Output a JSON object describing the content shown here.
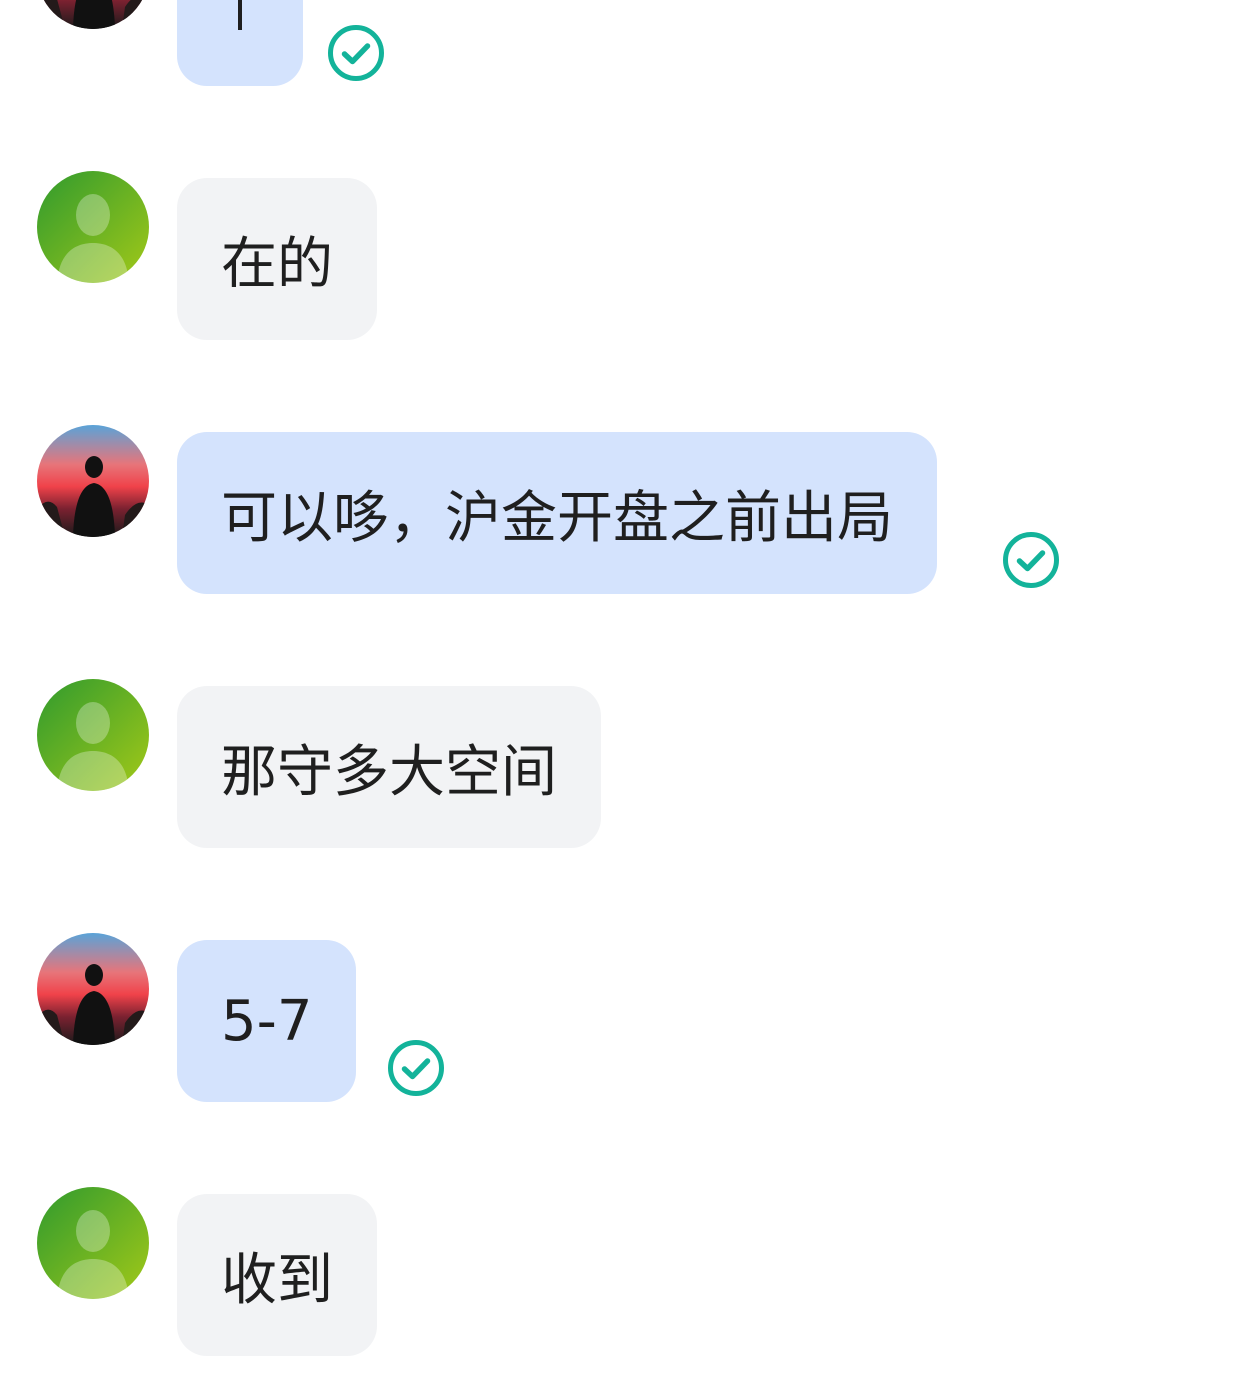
{
  "colors": {
    "sent_bubble": "#d4e3fd",
    "received_bubble": "#f2f3f5",
    "read_check": "#13b39a",
    "text": "#1f1f1f"
  },
  "messages": [
    {
      "direction": "sent",
      "text": "",
      "status_icon": "read-check-icon",
      "avatar": "sunset-silhouette-avatar"
    },
    {
      "direction": "received",
      "text": "在的",
      "avatar": "default-green-avatar"
    },
    {
      "direction": "sent",
      "text": "可以哆，沪金开盘之前出局",
      "status_icon": "read-check-icon",
      "avatar": "sunset-silhouette-avatar"
    },
    {
      "direction": "received",
      "text": "那守多大空间",
      "avatar": "default-green-avatar"
    },
    {
      "direction": "sent",
      "text": "5-7",
      "status_icon": "read-check-icon",
      "avatar": "sunset-silhouette-avatar"
    },
    {
      "direction": "received",
      "text": "收到",
      "avatar": "default-green-avatar"
    }
  ]
}
